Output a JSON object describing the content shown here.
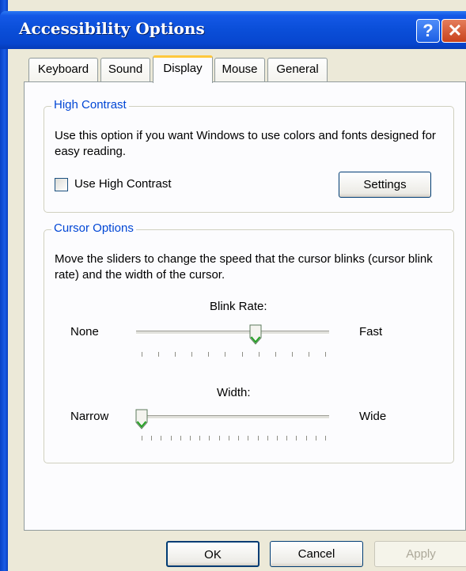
{
  "window": {
    "title": "Accessibility Options",
    "help_glyph": "?",
    "close_glyph": "✕"
  },
  "tabs": [
    {
      "label": "Keyboard",
      "active": false
    },
    {
      "label": "Sound",
      "active": false
    },
    {
      "label": "Display",
      "active": true
    },
    {
      "label": "Mouse",
      "active": false
    },
    {
      "label": "General",
      "active": false
    }
  ],
  "high_contrast": {
    "legend": "High Contrast",
    "description": "Use this option if you want Windows to use colors and fonts designed for easy reading.",
    "checkbox_label": "Use High Contrast",
    "checked": false,
    "settings_label": "Settings"
  },
  "cursor_options": {
    "legend": "Cursor Options",
    "description": "Move the sliders to change the speed that the cursor blinks (cursor blink rate) and the width of the cursor.",
    "blink_rate": {
      "label": "Blink Rate:",
      "min_label": "None",
      "max_label": "Fast",
      "value_fraction": 0.62,
      "tick_count": 12
    },
    "width": {
      "label": "Width:",
      "min_label": "Narrow",
      "max_label": "Wide",
      "value_fraction": 0.0,
      "tick_count": 20
    }
  },
  "buttons": {
    "ok": "OK",
    "cancel": "Cancel",
    "apply": "Apply"
  },
  "colors": {
    "title_bar": "#0a4ed8",
    "legend": "#0046d5",
    "face": "#ece9d8",
    "active_tab_accent": "#ffc83c"
  }
}
